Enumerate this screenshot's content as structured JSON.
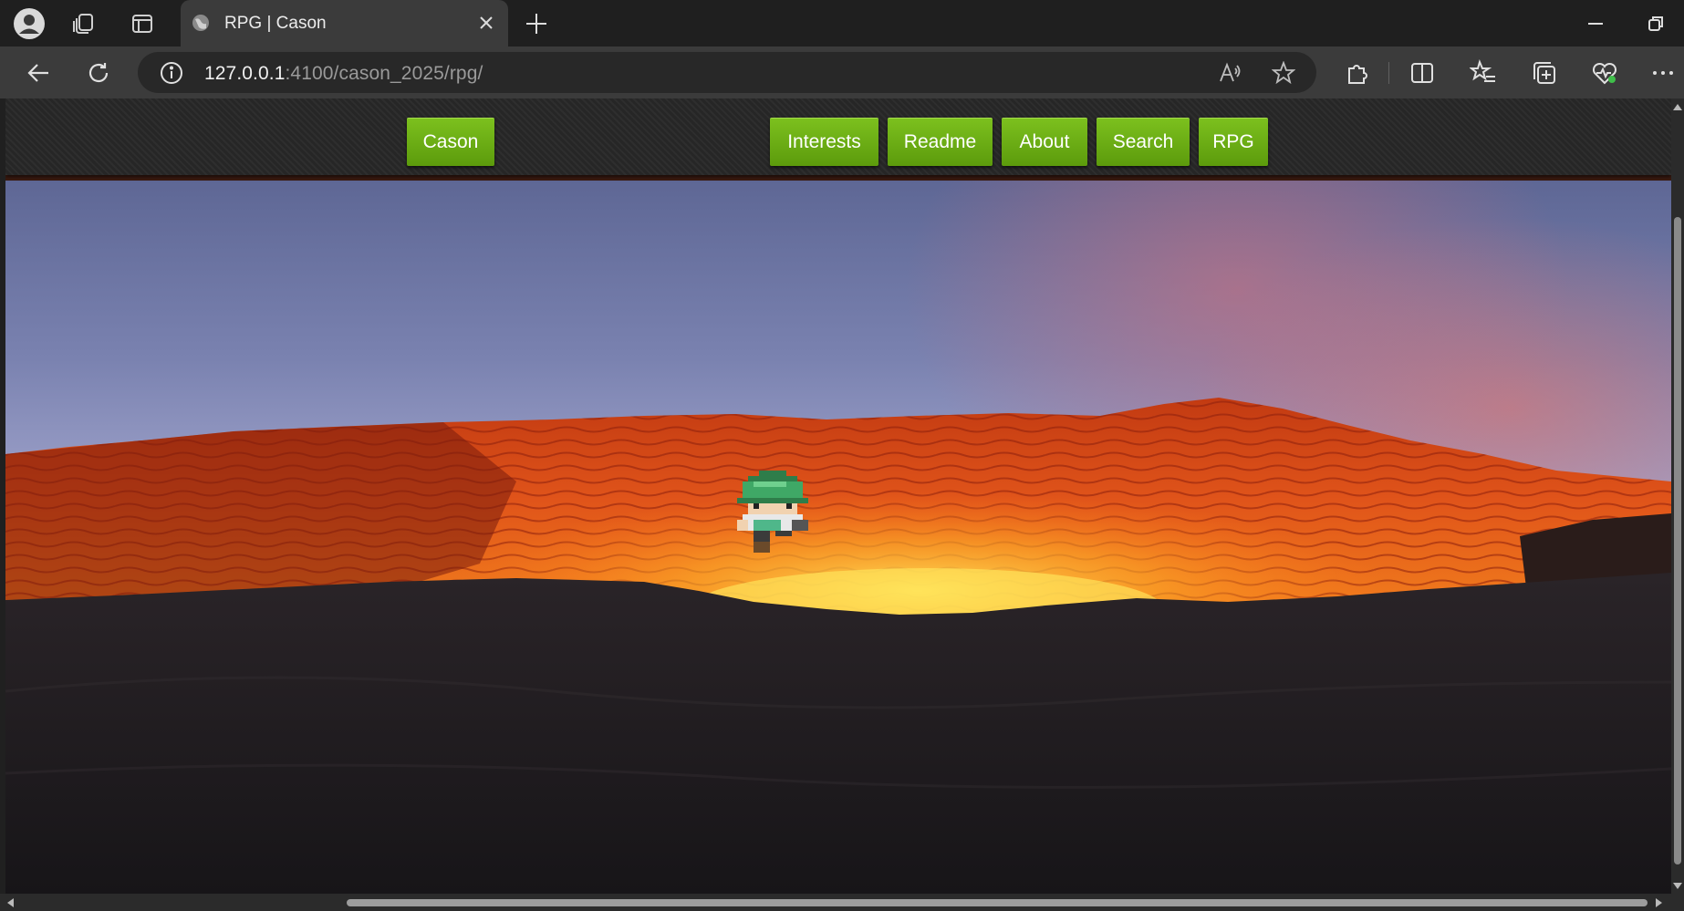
{
  "browser": {
    "tab_title": "RPG | Cason",
    "url_host": "127.0.0.1",
    "url_rest": ":4100/cason_2025/rpg/"
  },
  "icons": {
    "profile": "profile-icon",
    "workspaces": "workspaces-icon",
    "tab_actions": "tab-actions-icon",
    "favicon": "globe-favicon-icon",
    "close": "close-icon",
    "new_tab": "plus-icon",
    "back": "back-arrow-icon",
    "refresh": "refresh-icon",
    "info": "info-icon",
    "read_aloud": "read-aloud-icon",
    "favorite": "star-icon",
    "extensions": "puzzle-icon",
    "split": "split-screen-icon",
    "favorites": "favorites-list-icon",
    "collections": "collections-icon",
    "health": "browser-essentials-icon",
    "more": "more-icon"
  },
  "page": {
    "nav": {
      "brand": "Cason",
      "links": [
        "Interests",
        "Readme",
        "About",
        "Search",
        "RPG"
      ]
    },
    "accent_color": "#6aab14",
    "scene": "volcano lava crater background with pixel-art character sprite"
  }
}
